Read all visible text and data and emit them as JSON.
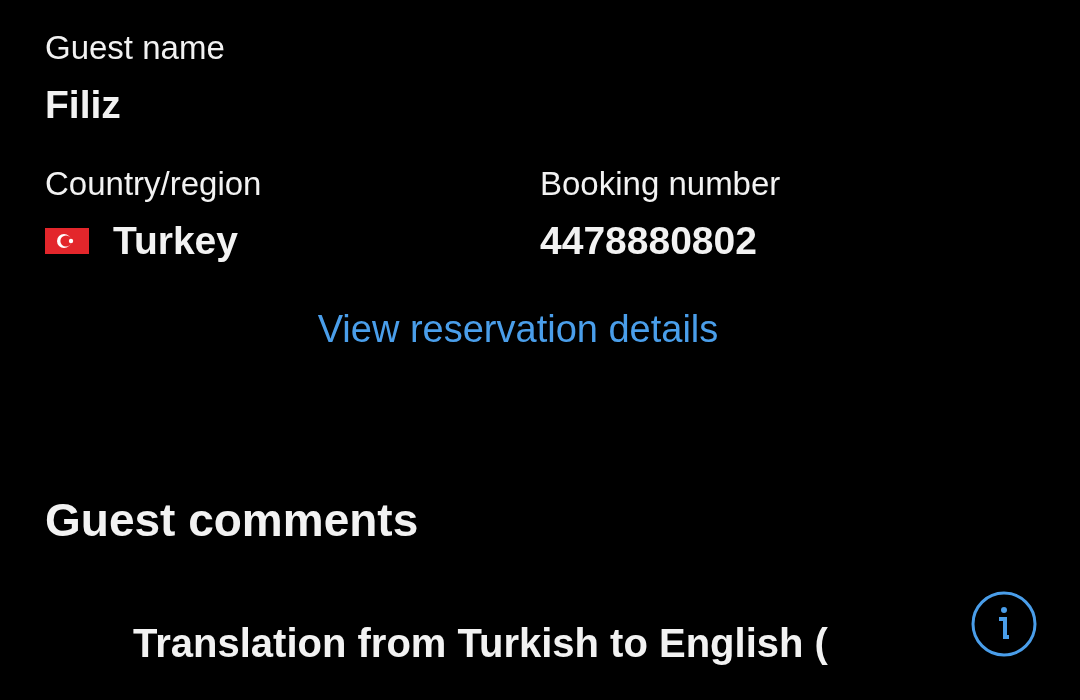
{
  "guest": {
    "name_label": "Guest name",
    "name": "Filiz"
  },
  "country": {
    "label": "Country/region",
    "value": "Turkey"
  },
  "booking": {
    "label": "Booking number",
    "value": "4478880802"
  },
  "link": "View reservation details",
  "comments": {
    "title": "Guest comments",
    "translation": "Translation from Turkish to English ("
  }
}
